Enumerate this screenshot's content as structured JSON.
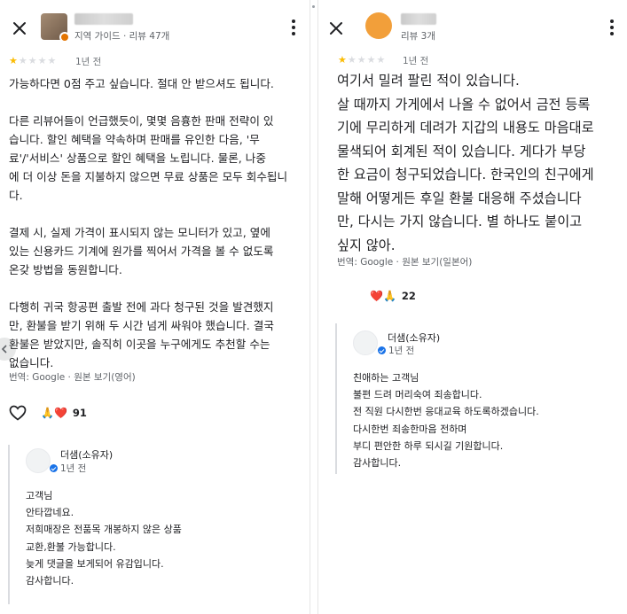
{
  "left": {
    "reviewer": {
      "meta": "지역 가이드 · 리뷰 47개"
    },
    "rating": 1,
    "rating_max": 5,
    "time": "1년 전",
    "review_text": "가능하다면 0점 주고 싶습니다. 절대 안 받으셔도 됩니다.\n\n다른 리뷰어들이 언급했듯이, 몇몇 음흉한 판매 전략이 있\n습니다. 할인 혜택을 약속하며 판매를 유인한 다음, '무\n료'/'서비스' 상품으로 할인 혜택을 노립니다. 물론, 나중\n에 더 이상 돈을 지불하지 않으면 무료 상품은 모두 회수됩니\n다.\n\n결제 시, 실제 가격이 표시되지 않는 모니터가 있고, 옆에\n있는 신용카드 기계에 원가를 찍어서 가격을 볼 수 없도록\n온갖 방법을 동원합니다.\n\n다행히 귀국 항공편 출발 전에 과다 청구된 것을 발견했지\n만, 환불을 받기 위해 두 시간 넘게 싸워야 했습니다. 결국\n환불은 받았지만, 솔직히 이곳을 누구에게도 추천할 수는\n없습니다.",
    "translated_note": "번역: Google · 원본 보기(영어)",
    "reactions": {
      "emoji": "🙏❤️",
      "count": "91"
    },
    "owner_reply": {
      "name": "더샘(소유자)",
      "time": "1년 전",
      "text": "고객님\n안타깝네요.\n저희매장은 전품목 개봉하지 않은 상품\n교환,환불 가능합니다.\n늦게 댓글을 보게되어 유감입니다.\n감사합니다."
    }
  },
  "right": {
    "reviewer": {
      "meta": "리뷰 3개"
    },
    "rating": 1,
    "rating_max": 5,
    "time": "1년 전",
    "review_text": "여기서 밀려 팔린 적이 있습니다.\n살 때까지 가게에서 나올 수 없어서 금전 등록\n기에 무리하게 데려가 지갑의 내용도 마음대로\n물색되어 회계된 적이 있습니다. 게다가 부당\n한 요금이 청구되었습니다. 한국인의 친구에게\n말해 어떻게든 후일 환불 대응해 주셨습니다\n만, 다시는 가지 않습니다. 별 하나도 붙이고\n싶지 않아.",
    "translated_note": "번역: Google · 원본 보기(일본어)",
    "reactions": {
      "emoji": "❤️🙏",
      "count": "22"
    },
    "owner_reply": {
      "name": "더샘(소유자)",
      "time": "1년 전",
      "text": "친애하는 고객님\n불편 드려 머리숙여 죄송합니다.\n전 직원 다시한번 응대교육 하도록하겠습니다.\n다시한번 죄송한마음 전하며\n부디 편안한 하루 되시길 기원합니다.\n감사합니다."
    }
  },
  "icons": {
    "close": "close-icon",
    "more": "more-vert-icon",
    "heart": "heart-outline-icon",
    "verified": "verified-badge-icon",
    "scroll": "chevron-left-icon"
  },
  "colors": {
    "star": "#fbbc04",
    "star_off": "#dadce0",
    "verified": "#1a73e8",
    "guide_badge": "#e37400"
  }
}
